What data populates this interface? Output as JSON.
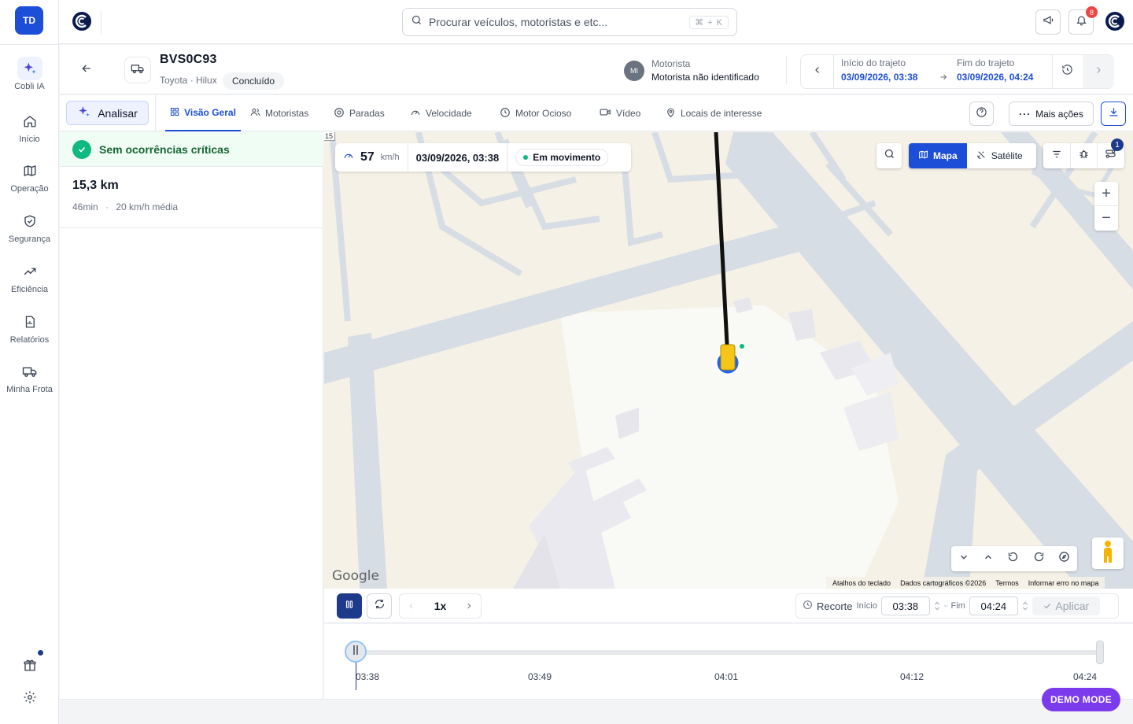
{
  "user": {
    "initials": "TD"
  },
  "sidebar": {
    "items": [
      {
        "label": "Cobli IA",
        "icon": "sparkles-icon"
      },
      {
        "label": "Início",
        "icon": "home-icon"
      },
      {
        "label": "Operação",
        "icon": "map-icon"
      },
      {
        "label": "Segurança",
        "icon": "shield-check-icon"
      },
      {
        "label": "Eficiência",
        "icon": "trending-up-icon"
      },
      {
        "label": "Relatórios",
        "icon": "report-icon"
      },
      {
        "label": "Minha Frota",
        "icon": "truck-icon"
      }
    ]
  },
  "topbar": {
    "search_placeholder": "Procurar veículos, motoristas e etc...",
    "shortcut": "⌘ + K",
    "notifications_count": "8"
  },
  "vehicle": {
    "plate": "BVS0C93",
    "model": "Toyota · Hilux",
    "status": "Concluído",
    "driver_initials": "MI",
    "driver_label": "Motorista",
    "driver_name": "Motorista não identificado"
  },
  "trip": {
    "start_label": "Início do trajeto",
    "start_value": "03/09/2026, 03:38",
    "end_label": "Fim do trajeto",
    "end_value": "03/09/2026, 04:24"
  },
  "tabs": {
    "analyze_label": "Analisar",
    "items": [
      {
        "label": "Visão Geral",
        "icon": "grid-icon"
      },
      {
        "label": "Motoristas",
        "icon": "users-icon"
      },
      {
        "label": "Paradas",
        "icon": "stop-icon"
      },
      {
        "label": "Velocidade",
        "icon": "gauge-icon"
      },
      {
        "label": "Motor Ocioso",
        "icon": "clock-icon"
      },
      {
        "label": "Vídeo",
        "icon": "video-icon"
      },
      {
        "label": "Locais de interesse",
        "icon": "pin-icon"
      }
    ],
    "more_label": "Mais ações"
  },
  "summary": {
    "status_text": "Sem ocorrências críticas",
    "distance": "15,3 km",
    "duration": "46min",
    "separator": "·",
    "avg_speed": "20 km/h média"
  },
  "map": {
    "speed_value": "57",
    "speed_unit": "km/h",
    "timestamp": "03/09/2026, 03:38",
    "state": "Em movimento",
    "type_map": "Mapa",
    "type_satellite": "Satélite",
    "filter_badge": "1",
    "route_shield": "15",
    "google_logo": "Google",
    "attribution": [
      "Atalhos do teclado",
      "Dados cartográficos ©2026",
      "Termos",
      "Informar erro no mapa"
    ],
    "colors": {
      "accent": "#1d4ed8",
      "vehicle": "#f5c518"
    }
  },
  "playback": {
    "speed": "1x",
    "clip_label": "Recorte",
    "start_label": "Início",
    "start_value": "03:38",
    "dash": "-",
    "end_label": "Fim",
    "end_value": "04:24",
    "apply_label": "Aplicar"
  },
  "timeline": {
    "ticks": [
      "03:38",
      "03:49",
      "04:01",
      "04:12",
      "04:24"
    ]
  },
  "demo_label": "DEMO MODE"
}
